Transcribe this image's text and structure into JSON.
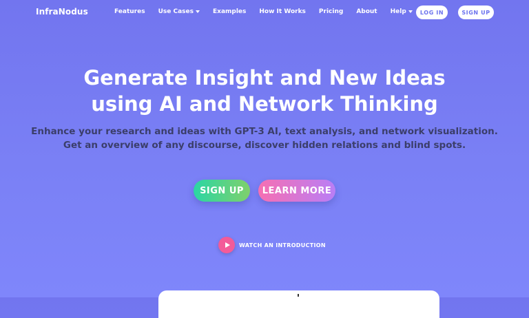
{
  "header": {
    "brand": "InfraNodus",
    "nav": [
      {
        "label": "Features",
        "dropdown": false
      },
      {
        "label": "Use Cases",
        "dropdown": true
      },
      {
        "label": "Examples",
        "dropdown": false
      },
      {
        "label": "How It Works",
        "dropdown": false
      },
      {
        "label": "Pricing",
        "dropdown": false
      },
      {
        "label": "About",
        "dropdown": false
      },
      {
        "label": "Help",
        "dropdown": true
      }
    ],
    "login_label": "LOG IN",
    "signup_label": "SIGN UP"
  },
  "hero": {
    "title_line1": "Generate Insight and New Ideas",
    "title_line2": "using AI and Network Thinking",
    "subtitle_line1": "Enhance your research and ideas with GPT-3 AI, text analysis, and network visualization.",
    "subtitle_line2": "Get an overview of any discourse, discover hidden relations and blind spots.",
    "signup_label": "SIGN UP",
    "learn_more_label": "LEARN MORE",
    "watch_label": "WATCH AN INTRODUCTION"
  },
  "colors": {
    "background": "#7478f2",
    "signup_gradient": [
      "#2bd6a4",
      "#7fd06c"
    ],
    "learn_more_gradient": [
      "#f66fb2",
      "#b97ef6"
    ],
    "play_button": "#f35b99",
    "subtitle_text": "#3b3e6a"
  },
  "icons": {
    "dropdown": "caret-down-icon",
    "watch": "play-icon"
  }
}
